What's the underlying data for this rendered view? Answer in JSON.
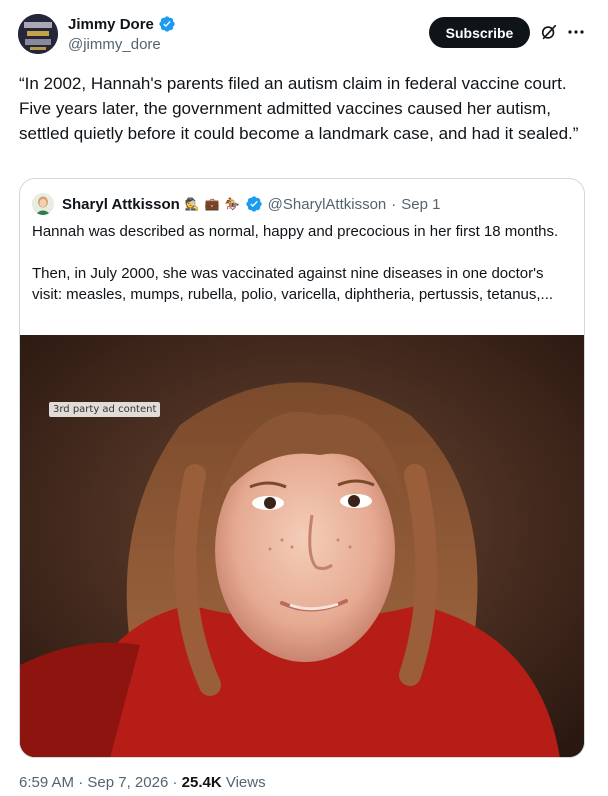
{
  "author": {
    "display_name": "Jimmy Dore",
    "handle": "@jimmy_dore",
    "verified": true
  },
  "actions": {
    "subscribe_label": "Subscribe",
    "grok_icon": "grok-slash-icon",
    "more_icon": "more-dots-icon"
  },
  "tweet": {
    "text": "“In 2002, Hannah's parents filed an autism claim in federal vaccine court. Five years later, the government admitted vaccines caused her autism, settled quietly before it could become a landmark case, and had it sealed.”"
  },
  "quote": {
    "display_name": "Sharyl Attkisson",
    "name_emojis": [
      "🕵",
      "💼",
      "🏇"
    ],
    "verified": true,
    "handle": "@SharylAttkisson",
    "separator": "·",
    "date": "Sep 1",
    "paragraphs": [
      "Hannah was described as normal, happy and precocious in her first 18 months.",
      "Then, in July 2000, she was vaccinated against nine diseases in one doctor's visit: measles, mumps, rubella, polio, varicella, diphtheria, pertussis, tetanus,..."
    ],
    "media": {
      "ad_label": "3rd party ad content",
      "alt": "photo"
    }
  },
  "meta": {
    "time": "6:59 AM",
    "separator": "·",
    "date": "Sep 7, 2026",
    "views_count": "25.4K",
    "views_label": "Views"
  },
  "colors": {
    "text_primary": "#0f1419",
    "text_secondary": "#536471",
    "verified_blue": "#1d9bf0",
    "border": "#cfd9de",
    "button_bg": "#0f1419"
  }
}
